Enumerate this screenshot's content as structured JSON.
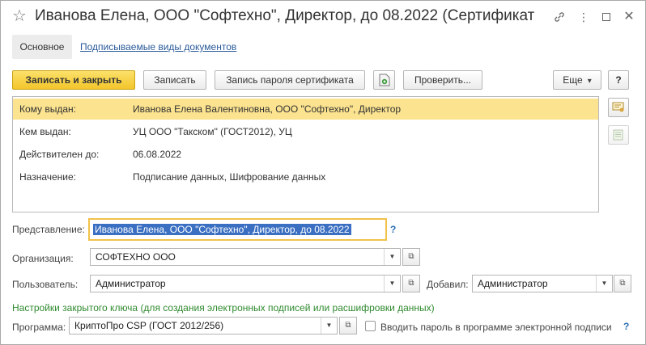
{
  "window": {
    "title": "Иванова Елена, ООО \"Софтехно\", Директор, до 08.2022 (Сертификат ..."
  },
  "tabs": {
    "main": "Основное",
    "signed_types": "Подписываемые виды документов"
  },
  "toolbar": {
    "save_close": "Записать и закрыть",
    "save": "Записать",
    "cert_password": "Запись пароля сертификата",
    "check": "Проверить...",
    "more": "Еще",
    "help": "?"
  },
  "info": {
    "rows": [
      {
        "key": "Кому выдан:",
        "value": "Иванова Елена Валентиновна, ООО \"Софтехно\", Директор"
      },
      {
        "key": "Кем выдан:",
        "value": "УЦ ООО \"Такском\" (ГОСТ2012), УЦ"
      },
      {
        "key": "Действителен до:",
        "value": "06.08.2022"
      },
      {
        "key": "Назначение:",
        "value": "Подписание данных, Шифрование данных"
      }
    ]
  },
  "form": {
    "presentation_label": "Представление:",
    "presentation_value": "Иванова Елена, ООО \"Софтехно\", Директор, до 08.2022",
    "organization_label": "Организация:",
    "organization_value": "СОФТЕХНО ООО",
    "user_label": "Пользователь:",
    "user_value": "Администратор",
    "added_label": "Добавил:",
    "added_value": "Администратор",
    "private_key_section": "Настройки закрытого ключа (для создания электронных подписей или расшифровки данных)",
    "program_label": "Программа:",
    "program_value": "КриптоПро CSP (ГОСТ 2012/256)",
    "enter_password_label": "Вводить пароль в программе электронной подписи",
    "help": "?"
  },
  "colors": {
    "primary_button": "#f3c62b",
    "selected_row": "#fbe38f",
    "link": "#2a5a9a",
    "section_title": "#2f8a2f",
    "focus_border": "#f0c24a"
  }
}
